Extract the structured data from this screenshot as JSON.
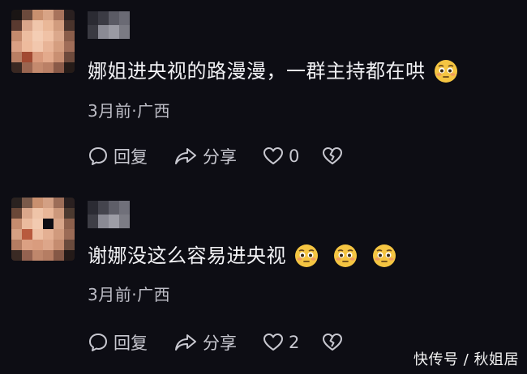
{
  "comments": [
    {
      "text": "娜姐进央视的路漫漫，一群主持都在哄",
      "emoji_count": 1,
      "meta": "3月前·广西",
      "reply_label": "回复",
      "share_label": "分享",
      "like_count": "0",
      "icons": [
        "reply-icon",
        "share-icon",
        "heart-icon",
        "broken-heart-icon",
        "flushed-face-emoji"
      ]
    },
    {
      "text": "谢娜没这么容易进央视",
      "emoji_count": 3,
      "meta": "3月前·广西",
      "reply_label": "回复",
      "share_label": "分享",
      "like_count": "2",
      "icons": [
        "reply-icon",
        "share-icon",
        "heart-icon",
        "broken-heart-icon",
        "flushed-face-emoji"
      ]
    }
  ],
  "watermark": "快传号 / 秋姐居",
  "colors": {
    "background": "#0d0d14",
    "text": "#f1f1f4",
    "muted": "#bdbdc6",
    "emoji": "#f5c542"
  }
}
